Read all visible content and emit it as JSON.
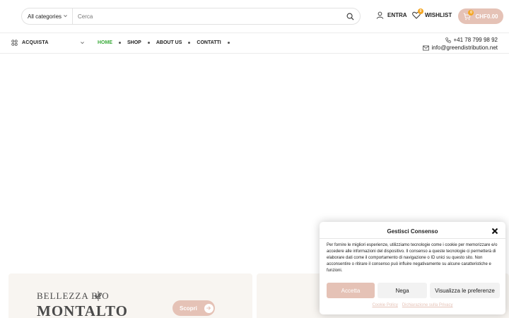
{
  "header": {
    "category_select": "All categories",
    "search_placeholder": "Cerca",
    "account_label": "ENTRA",
    "wishlist_label": "WISHLIST",
    "wishlist_count": "0",
    "cart_count": "0",
    "cart_total": "CHF0.00"
  },
  "nav": {
    "shop_menu_label": "ACQUISTA",
    "links": [
      "HOME",
      "SHOP",
      "ABOUT US",
      "CONTATTI"
    ],
    "active_link": "HOME",
    "phone": "+41 78 799 98 92",
    "email": "info@greendistribution.net"
  },
  "banners": [
    {
      "logo_top": "BELLEZZA BIO",
      "logo_main": "MONTALTO",
      "button_label": "Scopri"
    },
    {
      "logo_top": "",
      "logo_main": "",
      "button_label": ""
    }
  ],
  "consent": {
    "title": "Gestisci Consenso",
    "text": "Per fornire le migliori esperienze, utilizziamo tecnologie come i cookie per memorizzare e/o accedere alle informazioni del dispositivo. Il consenso a queste tecnologie ci permetterà di elaborare dati come il comportamento di navigazione o ID unici su questo sito. Non acconsentire o ritirare il consenso può influire negativamente su alcune caratteristiche e funzioni.",
    "accept_label": "Accetta",
    "deny_label": "Nega",
    "preferences_label": "Visualizza le preferenze",
    "cookie_policy_link": "Cookie Policy",
    "privacy_link": "Dichiarazione sulla Privacy"
  },
  "colors": {
    "accent": "#e5c2b6",
    "active_nav": "#3bab3a",
    "badge": "#f4a623",
    "banner_bg": "#f8f5f1"
  },
  "icons": [
    "chevron-down-icon",
    "search-icon",
    "user-icon",
    "heart-icon",
    "cart-icon",
    "grid-icon",
    "phone-icon",
    "mail-icon",
    "close-icon",
    "arrow-right-icon",
    "leaf-icon"
  ]
}
